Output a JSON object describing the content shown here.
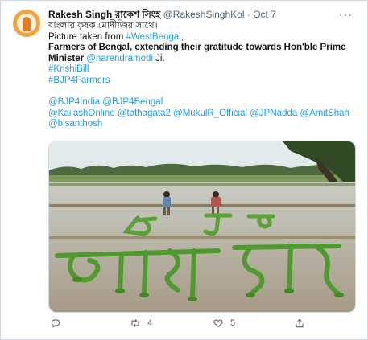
{
  "tweet": {
    "author_name": "Rakesh Singh রাকেশ সিংহ",
    "handle": "@RakeshSinghKol",
    "separator": "·",
    "date": "Oct 7",
    "more_icon": "more-icon",
    "lines": {
      "bengali": "বাংলার কৃষক মোদীজির সাথে।",
      "picture_prefix": "Picture taken from ",
      "picture_tag": "#WestBengal",
      "picture_suffix": ",",
      "bold1": "Farmers of Bengal, extending their gratitude towards Hon'ble Prime",
      "bold2": "Minister",
      "mention_modi": "@narendramodi",
      "ji": " Ji.",
      "tag_krishibill": "#KrishiBill",
      "tag_bjp4farmers": "#BJP4Farmers",
      "mentions1": "@BJP4India @BJP4Bengal",
      "mentions2": "@KailashOnline @tathagata2 @MukulR_Official @JPNadda @AmitShah",
      "mentions3": "@blsanthosh"
    },
    "image": {
      "description_icon": "farmers-field-photo"
    },
    "actions": {
      "reply_icon": "reply-icon",
      "reply_count": "",
      "retweet_icon": "retweet-icon",
      "retweet_count": "4",
      "like_icon": "heart-icon",
      "like_count": "5",
      "share_icon": "share-icon"
    }
  }
}
